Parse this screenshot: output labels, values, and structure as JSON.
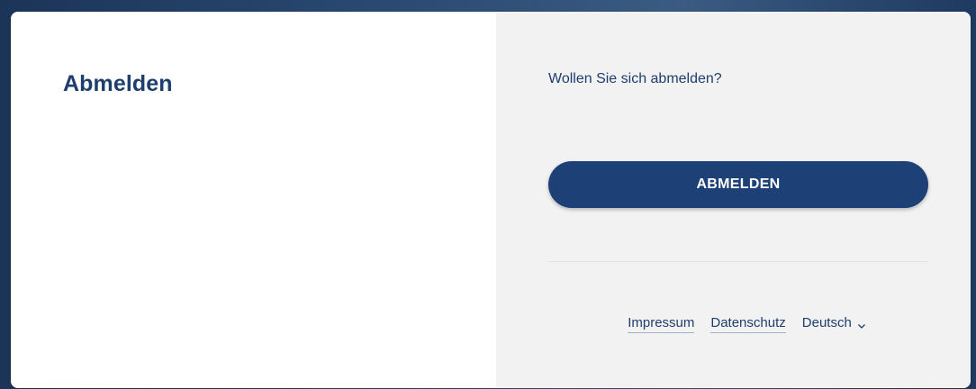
{
  "left": {
    "title": "Abmelden"
  },
  "right": {
    "question": "Wollen Sie sich abmelden?",
    "logout_button_label": "ABMELDEN"
  },
  "footer": {
    "impressum_label": "Impressum",
    "datenschutz_label": "Datenschutz",
    "language_selected": "Deutsch",
    "language_icon": "chevron-down-icon"
  },
  "colors": {
    "primary": "#1d4177",
    "text": "#1d3e6e",
    "panel_gray": "#f2f2f2"
  }
}
